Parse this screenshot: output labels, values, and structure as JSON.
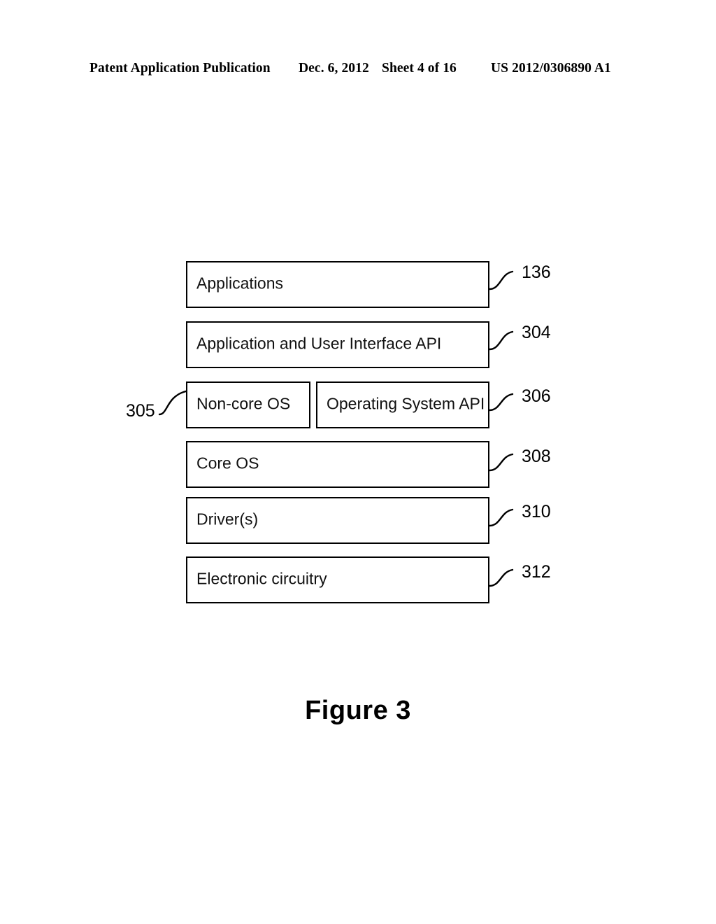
{
  "header": {
    "publication": "Patent Application Publication",
    "date": "Dec. 6, 2012",
    "sheet": "Sheet 4 of 16",
    "patent_number": "US 2012/0306890 A1"
  },
  "figure": {
    "caption": "Figure 3",
    "boxes": [
      {
        "id": "applications",
        "label": "Applications",
        "ref": "136"
      },
      {
        "id": "aui-api",
        "label": "Application and User Interface API",
        "ref": "304"
      },
      {
        "id": "noncore-os",
        "label": "Non-core OS",
        "ref": "305"
      },
      {
        "id": "os-api",
        "label": "Operating System API",
        "ref": "306"
      },
      {
        "id": "core-os",
        "label": "Core OS",
        "ref": "308"
      },
      {
        "id": "drivers",
        "label": "Driver(s)",
        "ref": "310"
      },
      {
        "id": "electronic-circuitry",
        "label": "Electronic circuitry",
        "ref": "312"
      }
    ],
    "reference_numerals": {
      "applications": "136",
      "aui_api": "304",
      "noncore_os": "305",
      "os_api": "306",
      "core_os": "308",
      "drivers": "310",
      "electronic_circuitry": "312"
    }
  },
  "colors": {
    "page_background": "#ffffff",
    "ink": "#000000",
    "box_fill": "#ffffff"
  }
}
